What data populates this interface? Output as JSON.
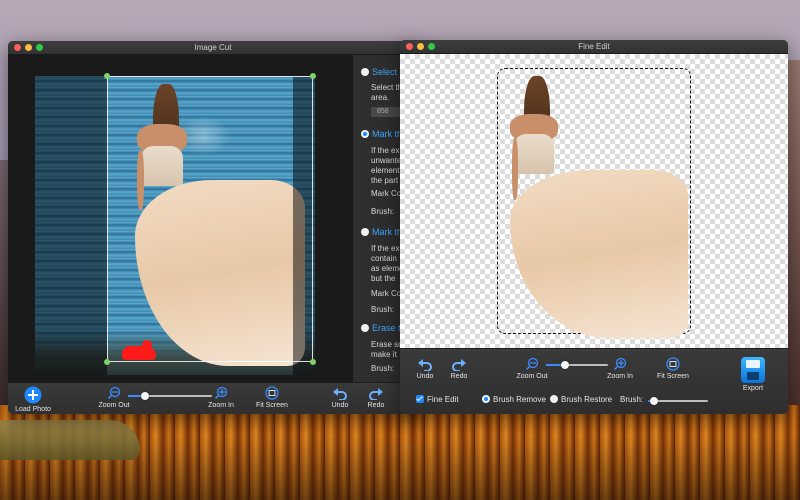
{
  "image_cut": {
    "title": "Image Cut",
    "options": {
      "select": {
        "heading": "Select c",
        "desc1": "Select th",
        "desc2": "area.",
        "value": "858"
      },
      "mark_keep": {
        "heading": "Mark th",
        "l1": "If the ex",
        "l2": "unwante",
        "l3": "element",
        "l4": "the part",
        "color_label": "Mark Co",
        "brush_label": "Brush:"
      },
      "mark_remove": {
        "heading": "Mark th",
        "l1": "If the ex",
        "l2": "contain",
        "l3": "as eleme",
        "l4": "but the",
        "color_label": "Mark Co",
        "brush_label": "Brush:"
      },
      "erase": {
        "heading": "Erase t",
        "l1": "Erase so",
        "l2": "make it",
        "brush_label": "Brush:"
      }
    },
    "toolbar": {
      "load_photo": "Load Photo",
      "zoom_out": "Zoom Out",
      "zoom_in": "Zoom In",
      "fit_screen": "Fit Screen",
      "undo": "Undo",
      "redo": "Redo",
      "zoom_level": 0.2
    }
  },
  "fine_edit": {
    "title": "Fine Edit",
    "toolbar": {
      "undo": "Undo",
      "redo": "Redo",
      "zoom_out": "Zoom Out",
      "zoom_in": "Zoom In",
      "fit_screen": "Fit Screen",
      "export": "Export",
      "fine_edit": "Fine Edit",
      "brush_remove": "Brush Remove",
      "brush_restore": "Brush Restore",
      "brush": "Brush:",
      "zoom_level": 0.3,
      "brush_level": 0.1
    }
  },
  "colors": {
    "accent": "#1e88ff",
    "mark_red": "#ff1a1a",
    "handle_green": "#7fd36a"
  }
}
